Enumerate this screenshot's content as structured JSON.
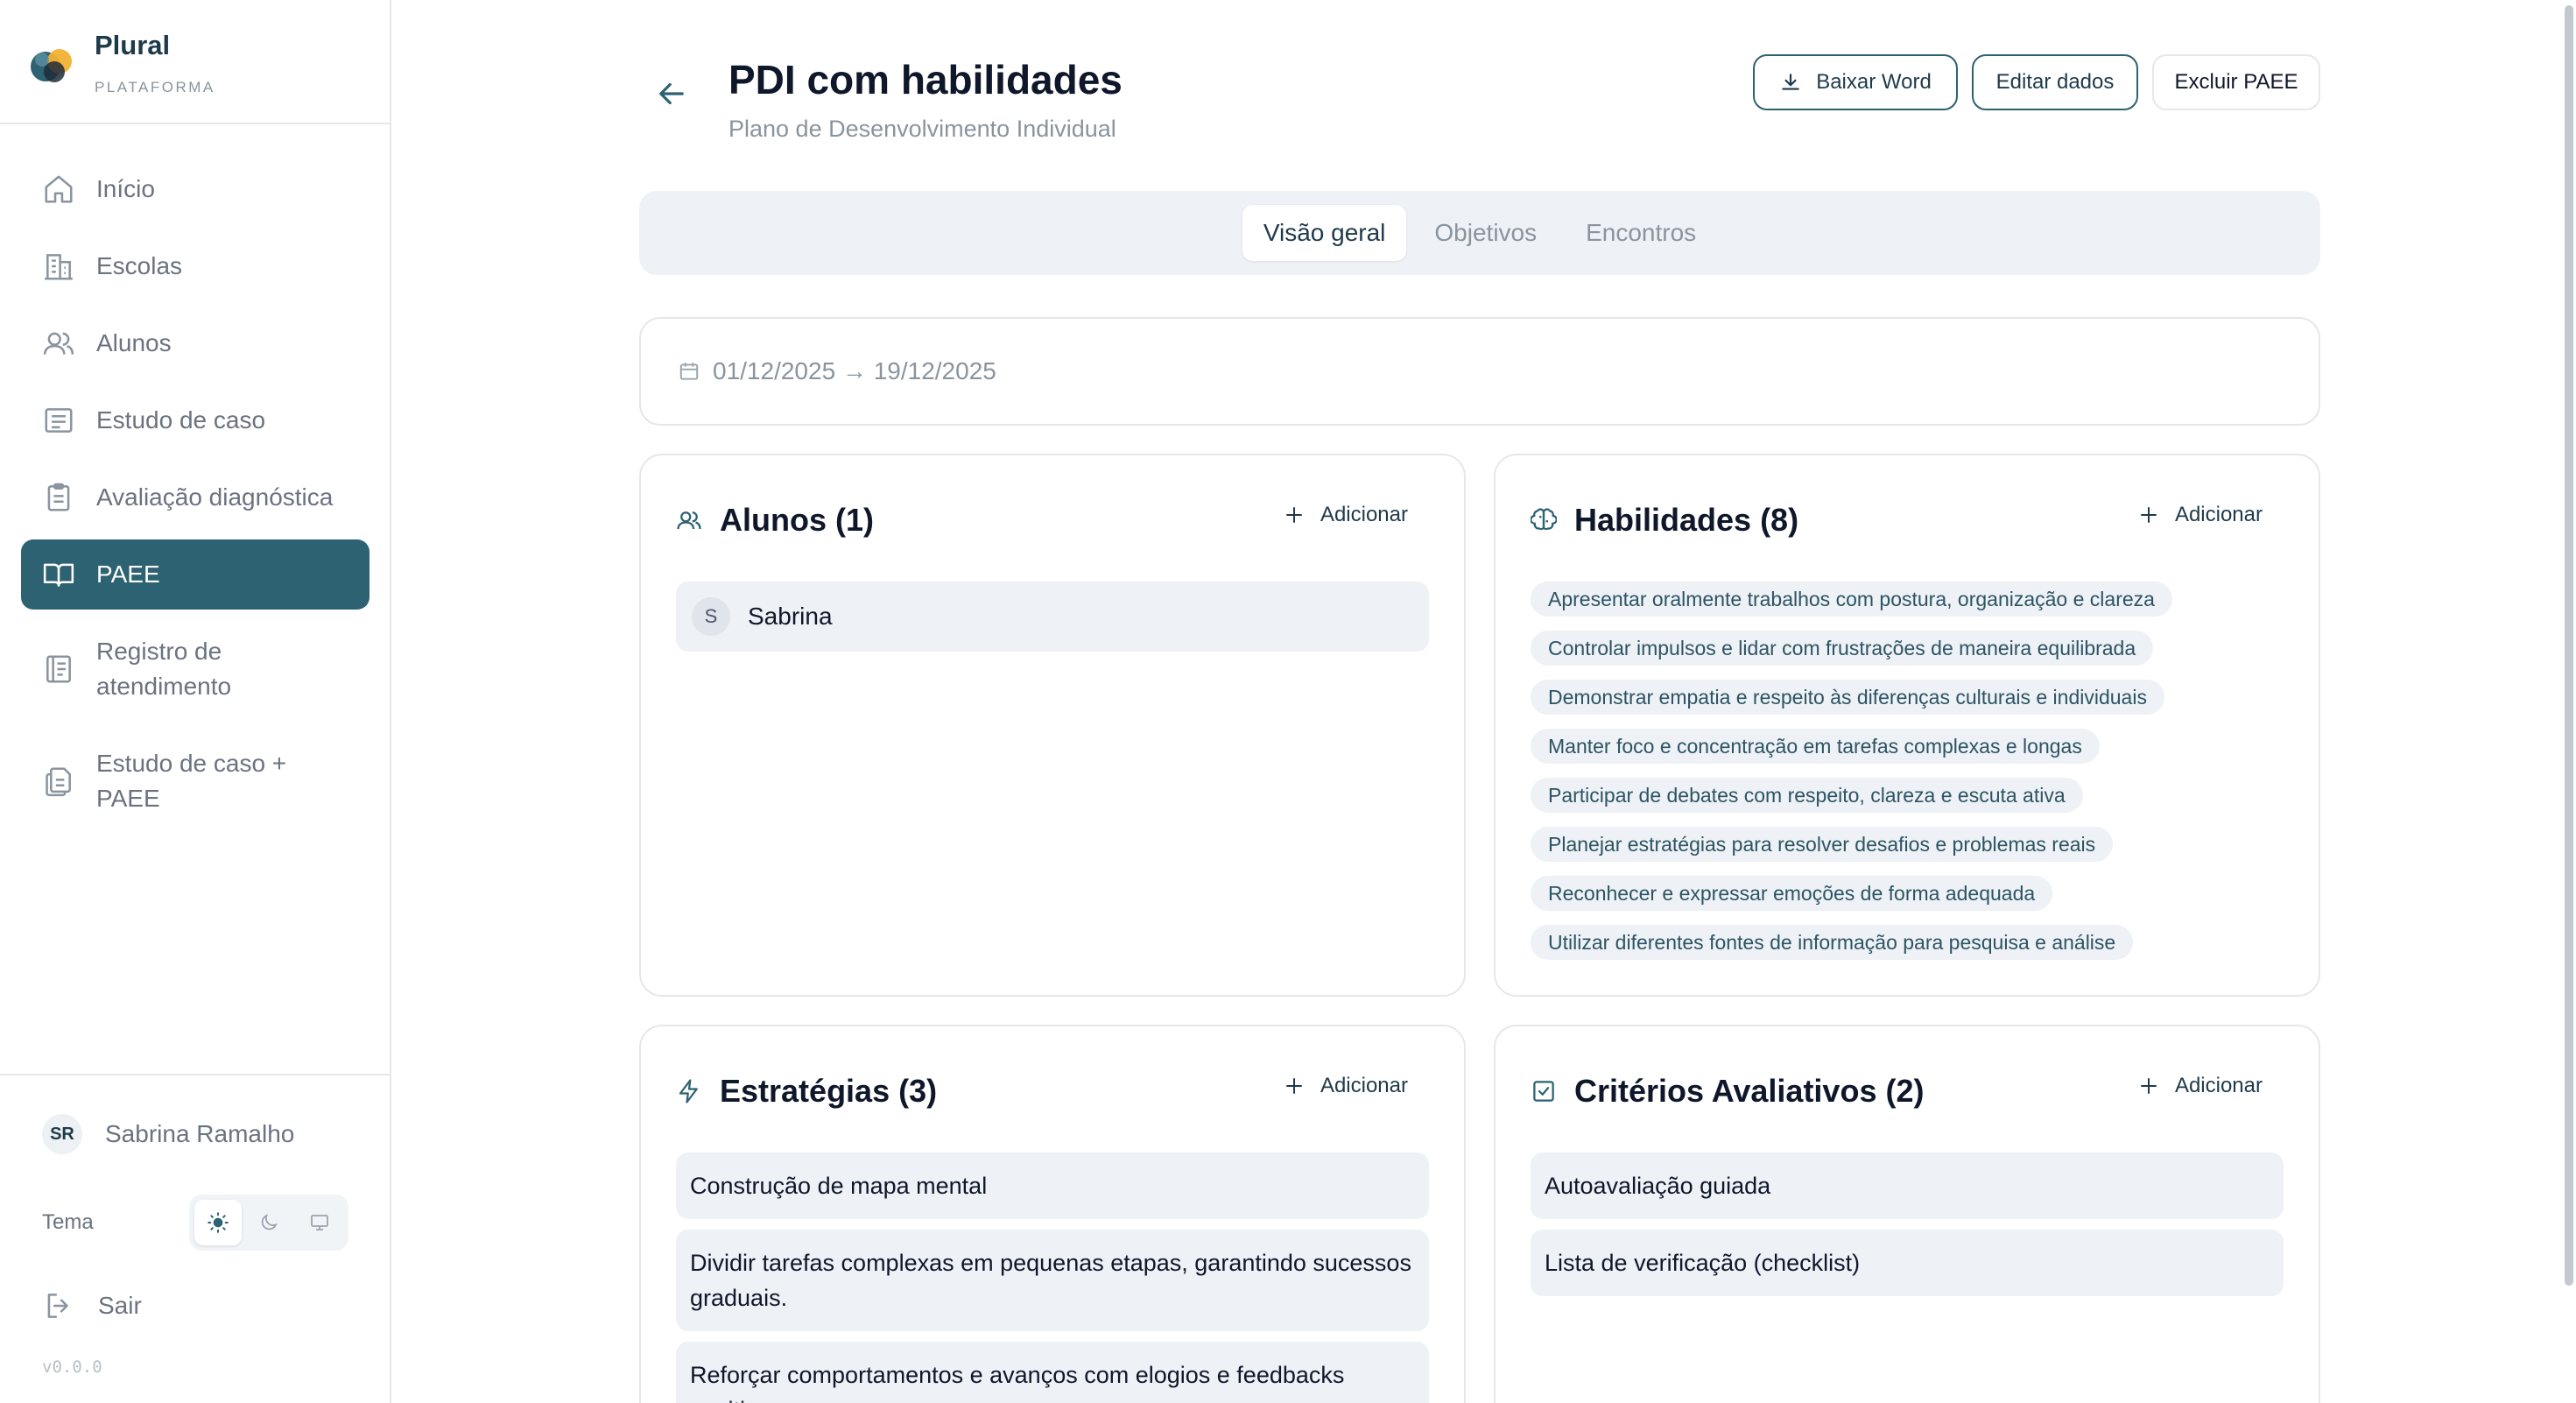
{
  "brand": {
    "name": "Plural",
    "subtitle": "PLATAFORMA"
  },
  "sidebar": {
    "items": [
      {
        "label": "Início",
        "icon": "home-icon"
      },
      {
        "label": "Escolas",
        "icon": "building-icon"
      },
      {
        "label": "Alunos",
        "icon": "users-icon"
      },
      {
        "label": "Estudo de caso",
        "icon": "document-list-icon"
      },
      {
        "label": "Avaliação diagnóstica",
        "icon": "clipboard-icon"
      },
      {
        "label": "PAEE",
        "icon": "book-open-icon",
        "active": true
      },
      {
        "label": "Registro de atendimento",
        "icon": "notebook-icon"
      },
      {
        "label": "Estudo de caso + PAEE",
        "icon": "files-icon"
      }
    ],
    "user": {
      "initials": "SR",
      "name": "Sabrina Ramalho"
    },
    "theme_label": "Tema",
    "logout_label": "Sair",
    "version": "v0.0.0"
  },
  "header": {
    "title": "PDI com habilidades",
    "subtitle": "Plano de Desenvolvimento Individual",
    "buttons": {
      "download_word": "Baixar Word",
      "edit": "Editar dados",
      "delete": "Excluir PAEE"
    }
  },
  "tabs": [
    {
      "label": "Visão geral",
      "active": true
    },
    {
      "label": "Objetivos"
    },
    {
      "label": "Encontros"
    }
  ],
  "period": "01/12/2025 → 19/12/2025",
  "cards": {
    "add_label": "Adicionar",
    "alunos": {
      "title": "Alunos (1)",
      "items": [
        {
          "initial": "S",
          "name": "Sabrina"
        }
      ]
    },
    "habilidades": {
      "title": "Habilidades (8)",
      "items": [
        "Apresentar oralmente trabalhos com postura, organização e clareza",
        "Controlar impulsos e lidar com frustrações de maneira equilibrada",
        "Demonstrar empatia e respeito às diferenças culturais e individuais",
        "Manter foco e concentração em tarefas complexas e longas",
        "Participar de debates com respeito, clareza e escuta ativa",
        "Planejar estratégias para resolver desafios e problemas reais",
        "Reconhecer e expressar emoções de forma adequada",
        "Utilizar diferentes fontes de informação para pesquisa e análise"
      ]
    },
    "estrategias": {
      "title": "Estratégias (3)",
      "items": [
        "Construção de mapa mental",
        "Dividir tarefas complexas em pequenas etapas, garantindo sucessos graduais.",
        "Reforçar comportamentos e avanços com elogios e feedbacks positivos."
      ]
    },
    "criterios": {
      "title": "Critérios Avaliativos (2)",
      "items": [
        "Autoavaliação guiada",
        "Lista de verificação (checklist)"
      ]
    }
  },
  "colors": {
    "accent": "#2c6272",
    "muted": "#8a949e",
    "surface": "#eef1f5"
  }
}
